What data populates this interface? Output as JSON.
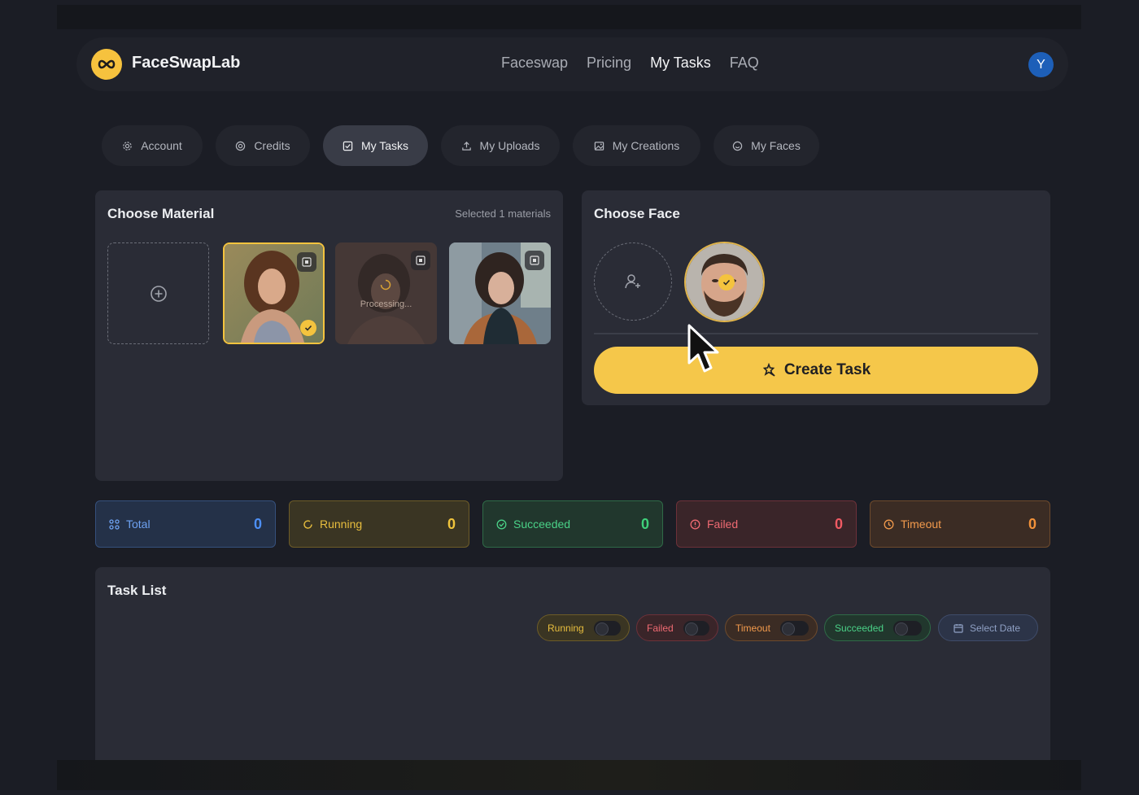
{
  "app": {
    "name": "FaceSwapLab",
    "avatar_initial": "Y"
  },
  "nav": [
    "Faceswap",
    "Pricing",
    "My Tasks",
    "FAQ"
  ],
  "nav_active": "My Tasks",
  "tabs": [
    {
      "label": "Account",
      "icon": "gear-icon"
    },
    {
      "label": "Credits",
      "icon": "coin-icon"
    },
    {
      "label": "My Tasks",
      "icon": "checkbox-icon",
      "active": true
    },
    {
      "label": "My Uploads",
      "icon": "upload-icon"
    },
    {
      "label": "My Creations",
      "icon": "image-icon"
    },
    {
      "label": "My Faces",
      "icon": "smile-icon"
    }
  ],
  "material": {
    "title": "Choose Material",
    "selected_text": "Selected 1 materials",
    "processing_label": "Processing..."
  },
  "face": {
    "title": "Choose Face",
    "create_label": "Create Task"
  },
  "stats": [
    {
      "label": "Total",
      "count": "0",
      "color": "#4d8ff5"
    },
    {
      "label": "Running",
      "count": "0",
      "color": "#f0c43c"
    },
    {
      "label": "Succeeded",
      "count": "0",
      "color": "#3fd07a"
    },
    {
      "label": "Failed",
      "count": "0",
      "color": "#f05a63"
    },
    {
      "label": "Timeout",
      "count": "0",
      "color": "#f3923a"
    }
  ],
  "task_list": {
    "title": "Task List",
    "filters": [
      {
        "label": "Running",
        "on": false
      },
      {
        "label": "Failed",
        "on": false
      },
      {
        "label": "Timeout",
        "on": false
      },
      {
        "label": "Succeeded",
        "on": false
      }
    ],
    "date_label": "Select Date"
  }
}
